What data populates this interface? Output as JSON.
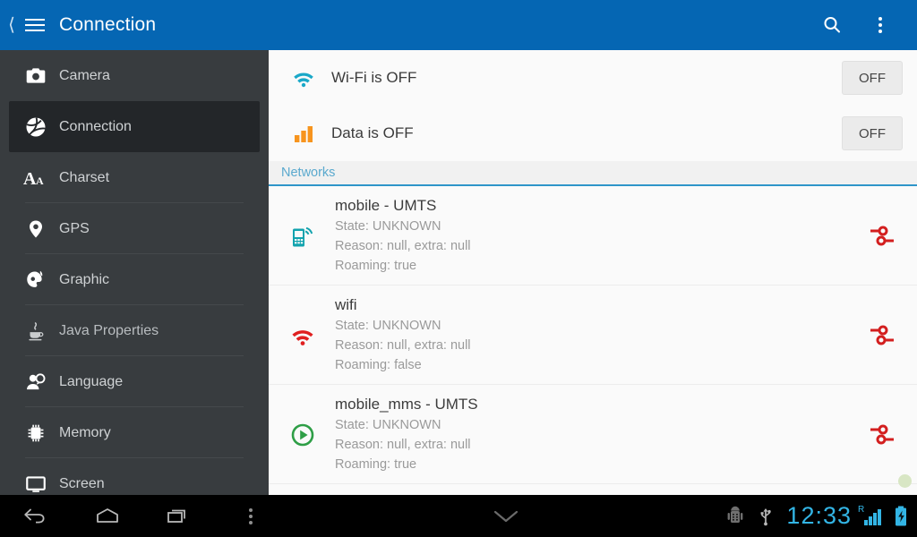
{
  "appbar": {
    "up_icon": "back-chevron-icon",
    "menu_icon": "hamburger-icon",
    "title": "Connection",
    "search_icon": "search-icon",
    "overflow_icon": "overflow-menu-icon",
    "background": "#0566b3"
  },
  "sidebar": {
    "items": [
      {
        "label": "Camera",
        "icon": "camera-icon",
        "selected": false
      },
      {
        "label": "Connection",
        "icon": "globe-network-icon",
        "selected": true
      },
      {
        "label": "Charset",
        "icon": "font-size-icon",
        "selected": false
      },
      {
        "label": "GPS",
        "icon": "location-pin-icon",
        "selected": false
      },
      {
        "label": "Graphic",
        "icon": "palette-brush-icon",
        "selected": false
      },
      {
        "label": "Java Properties",
        "icon": "java-cup-icon",
        "selected": false
      },
      {
        "label": "Language",
        "icon": "user-speech-icon",
        "selected": false
      },
      {
        "label": "Memory",
        "icon": "memory-chip-icon",
        "selected": false
      },
      {
        "label": "Screen",
        "icon": "monitor-icon",
        "selected": false
      }
    ],
    "selected_background": "#232629",
    "background": "#383c3f"
  },
  "content": {
    "toggles": [
      {
        "icon": "wifi-icon",
        "icon_color": "#1aa8c8",
        "label": "Wi-Fi is OFF",
        "button": "OFF"
      },
      {
        "icon": "signal-bars-icon",
        "icon_color": "#f7941e",
        "label": "Data is OFF",
        "button": "OFF"
      }
    ],
    "section": {
      "title": "Networks",
      "accent": "#2f95c9"
    },
    "networks": [
      {
        "icon": "mobile-signal-icon",
        "icon_color": "#12a3ae",
        "title": "mobile - UMTS",
        "state": "State: UNKNOWN",
        "reason": "Reason: null, extra: null",
        "roaming": "Roaming: true",
        "action_icon": "disconnected-plug-icon"
      },
      {
        "icon": "wifi-icon",
        "icon_color": "#e02020",
        "title": "wifi",
        "state": "State: UNKNOWN",
        "reason": "Reason: null, extra: null",
        "roaming": "Roaming: false",
        "action_icon": "disconnected-plug-icon"
      },
      {
        "icon": "play-circle-icon",
        "icon_color": "#2e9e46",
        "title": "mobile_mms - UMTS",
        "state": "State: UNKNOWN",
        "reason": "Reason: null, extra: null",
        "roaming": "Roaming: true",
        "action_icon": "disconnected-plug-icon"
      }
    ],
    "scroll_indicator": "scroll-position-dot"
  },
  "navbar": {
    "back_icon": "back-arrow-icon",
    "home_icon": "home-icon",
    "recents_icon": "recent-apps-icon",
    "menu_icon": "overflow-menu-icon",
    "collapse_icon": "chevron-down-icon",
    "status": {
      "adb_icon": "android-debug-icon",
      "usb_icon": "usb-icon",
      "clock": "12:33",
      "roaming_label": "R",
      "signal_icon": "signal-bars-icon",
      "battery_icon": "battery-charging-icon",
      "accent": "#33b5e5"
    }
  }
}
